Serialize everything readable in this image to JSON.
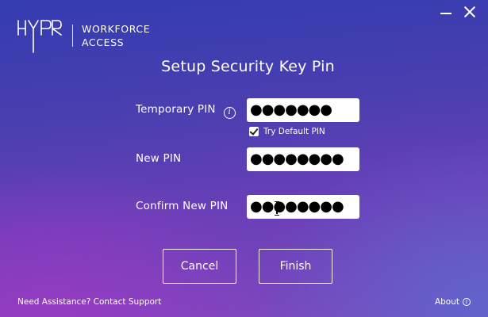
{
  "header": {
    "brand_line1": "WORKFORCE",
    "brand_line2": "ACCESS",
    "logo_icon": "hypr-logo"
  },
  "window_controls": {
    "minimize_icon": "minimize-icon",
    "close_icon": "close-icon"
  },
  "title": "Setup Security Key Pin",
  "form": {
    "temporary_pin": {
      "label": "Temporary PIN",
      "value": "●●●●●●●",
      "info_icon": "i"
    },
    "try_default": {
      "label": "Try Default PIN",
      "checked": true
    },
    "new_pin": {
      "label": "New PIN",
      "value": "●●●●●●●●"
    },
    "confirm_pin": {
      "label": "Confirm New PIN",
      "value": "●●●●●●●●"
    }
  },
  "buttons": {
    "cancel": "Cancel",
    "finish": "Finish"
  },
  "footer": {
    "assistance": "Need Assistance?",
    "contact": "Contact Support",
    "about": "About",
    "about_icon": "i"
  },
  "colors": {
    "bg_top": "#333cb0",
    "bg_bottom_left": "#9c38c4",
    "bg_bottom_right": "#5c68ce",
    "text": "#ffffff"
  }
}
